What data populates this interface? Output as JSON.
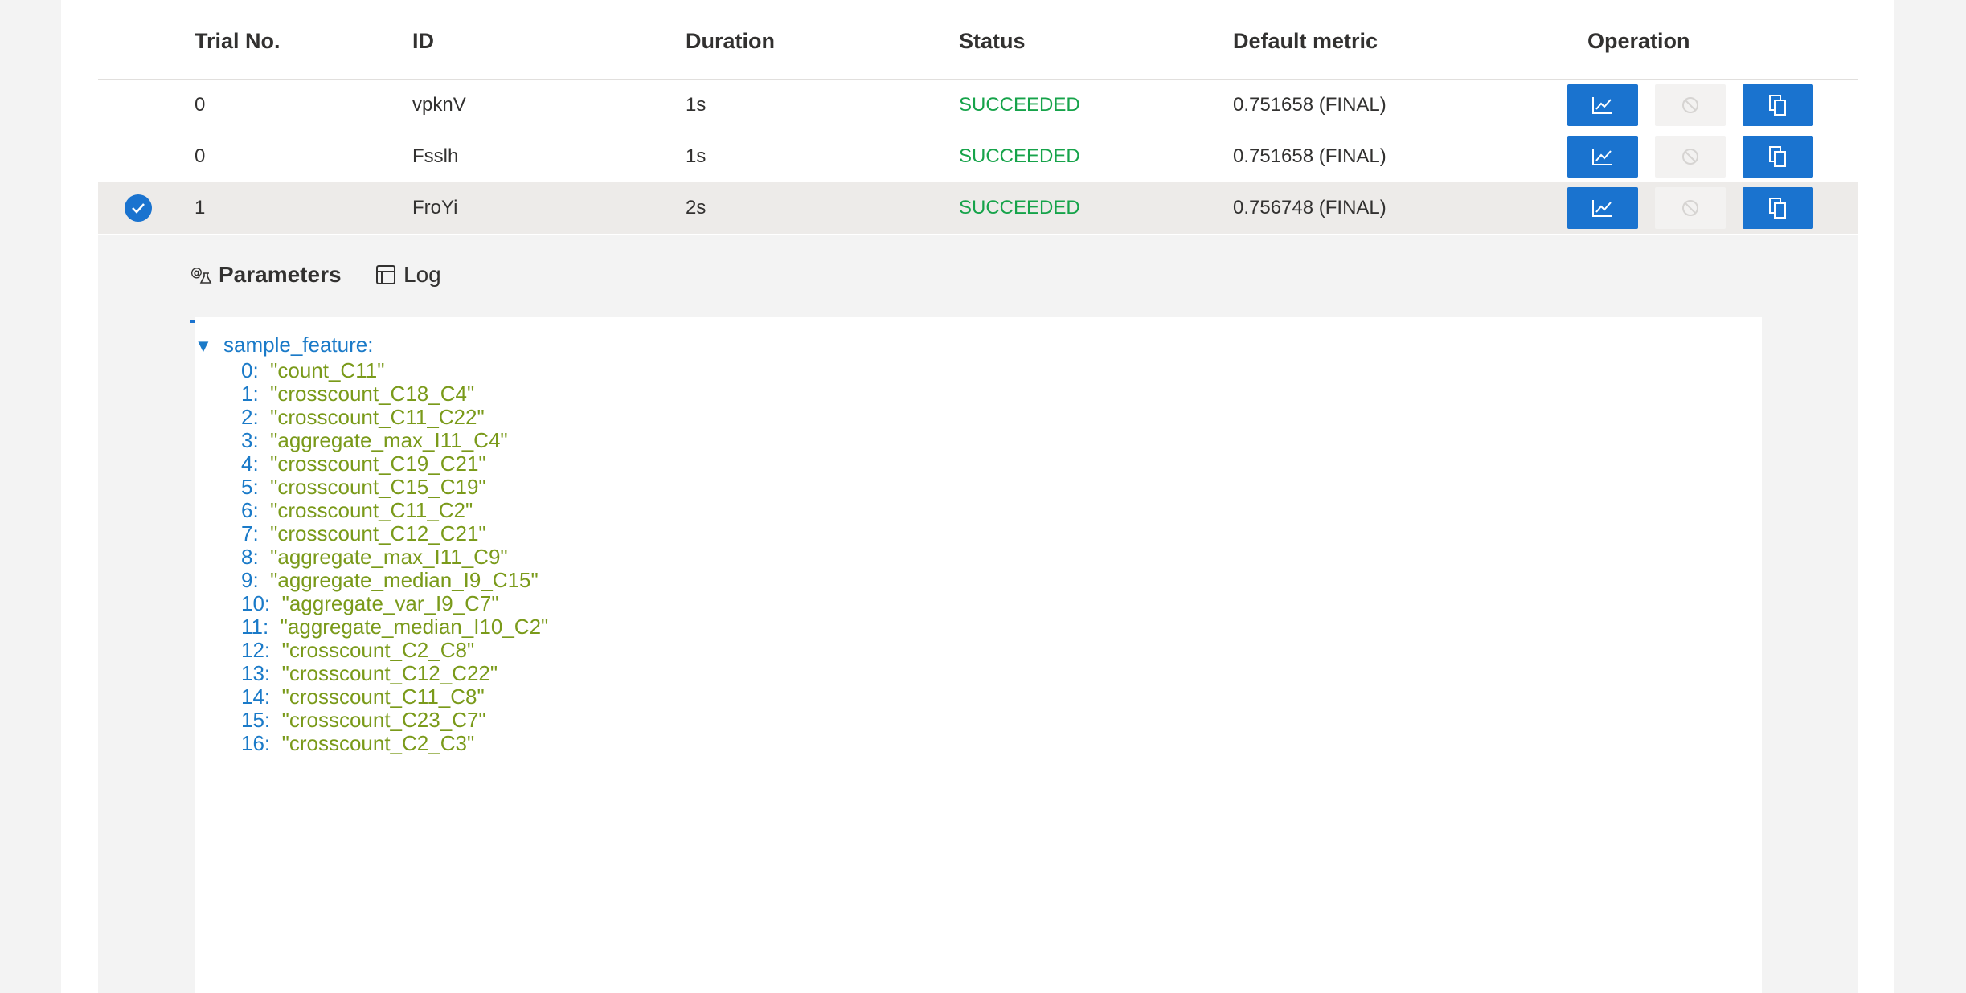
{
  "table": {
    "headers": [
      "Trial No.",
      "ID",
      "Duration",
      "Status",
      "Default metric",
      "Operation"
    ],
    "rows": [
      {
        "trial_no": "0",
        "id": "vpknV",
        "duration": "1s",
        "status": "SUCCEEDED",
        "metric": "0.751658 (FINAL)",
        "selected": false
      },
      {
        "trial_no": "0",
        "id": "Fsslh",
        "duration": "1s",
        "status": "SUCCEEDED",
        "metric": "0.751658 (FINAL)",
        "selected": false
      },
      {
        "trial_no": "1",
        "id": "FroYi",
        "duration": "2s",
        "status": "SUCCEEDED",
        "metric": "0.756748 (FINAL)",
        "selected": true
      }
    ]
  },
  "details": {
    "tabs": [
      {
        "label": "Parameters",
        "icon": "parameters-icon",
        "active": true
      },
      {
        "label": "Log",
        "icon": "log-icon",
        "active": false
      }
    ],
    "tree": {
      "root_key": "sample_feature:",
      "items": [
        {
          "key": "0:",
          "value": "\"count_C11\""
        },
        {
          "key": "1:",
          "value": "\"crosscount_C18_C4\""
        },
        {
          "key": "2:",
          "value": "\"crosscount_C11_C22\""
        },
        {
          "key": "3:",
          "value": "\"aggregate_max_I11_C4\""
        },
        {
          "key": "4:",
          "value": "\"crosscount_C19_C21\""
        },
        {
          "key": "5:",
          "value": "\"crosscount_C15_C19\""
        },
        {
          "key": "6:",
          "value": "\"crosscount_C11_C2\""
        },
        {
          "key": "7:",
          "value": "\"crosscount_C12_C21\""
        },
        {
          "key": "8:",
          "value": "\"aggregate_max_I11_C9\""
        },
        {
          "key": "9:",
          "value": "\"aggregate_median_I9_C15\""
        },
        {
          "key": "10:",
          "value": "\"aggregate_var_I9_C7\""
        },
        {
          "key": "11:",
          "value": "\"aggregate_median_I10_C2\""
        },
        {
          "key": "12:",
          "value": "\"crosscount_C2_C8\""
        },
        {
          "key": "13:",
          "value": "\"crosscount_C12_C22\""
        },
        {
          "key": "14:",
          "value": "\"crosscount_C11_C8\""
        },
        {
          "key": "15:",
          "value": "\"crosscount_C23_C7\""
        },
        {
          "key": "16:",
          "value": "\"crosscount_C2_C3\""
        }
      ]
    }
  },
  "colors": {
    "accent": "#1a73cf",
    "success": "#16a34a",
    "tree_key": "#1a7ac8",
    "tree_value": "#7a9a1a"
  }
}
